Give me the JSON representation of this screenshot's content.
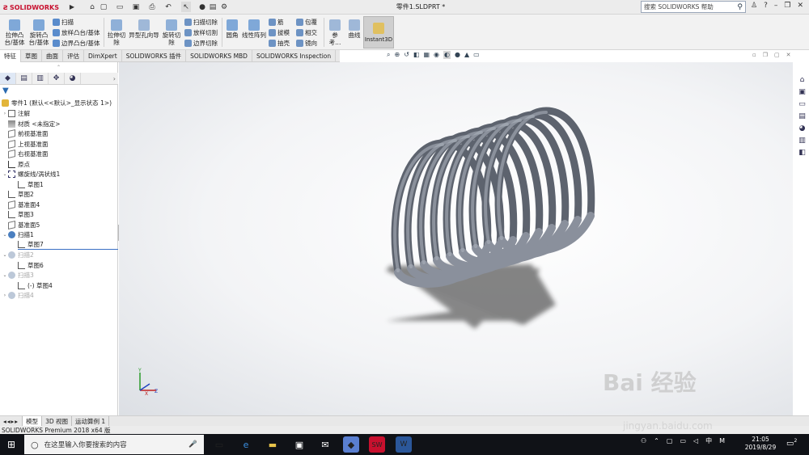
{
  "app": {
    "brand": "SOLIDWORKS",
    "document_title": "零件1.SLDPRT *"
  },
  "search": {
    "placeholder": "搜索 SOLIDWORKS 帮助"
  },
  "ribbon": {
    "extrude_boss": "拉伸凸\n台/基体",
    "revolve_boss": "旋转凸\n台/基体",
    "sweep": "扫描",
    "loft_boss": "放样凸台/基体",
    "boundary_boss": "边界凸台/基体",
    "extrude_cut": "拉伸切\n除",
    "hole_wizard": "异型孔向导",
    "revolve_cut": "旋转切\n除",
    "swept_cut": "扫描切除",
    "lofted_cut": "放样切割",
    "boundary_cut": "边界切除",
    "fillet": "圆角",
    "linear_pattern": "线性阵列",
    "rib": "筋",
    "draft": "拔模",
    "shell": "抽壳",
    "wrap": "包覆",
    "intersect": "相交",
    "mirror": "镜向",
    "reference": "参考...",
    "curves": "曲线",
    "instant3d": "Instant3D"
  },
  "command_tabs": [
    "特征",
    "草图",
    "曲面",
    "评估",
    "DimXpert",
    "SOLIDWORKS 插件",
    "SOLIDWORKS MBD",
    "SOLIDWORKS Inspection"
  ],
  "tree": {
    "root": "零件1 (默认<<默认>_显示状态 1>)",
    "items": [
      {
        "label": "注解"
      },
      {
        "label": "材质 <未指定>"
      },
      {
        "label": "前视基准面"
      },
      {
        "label": "上视基准面"
      },
      {
        "label": "右视基准面"
      },
      {
        "label": "原点"
      },
      {
        "label": "螺旋线/涡状线1"
      },
      {
        "label": "草图1"
      },
      {
        "label": "草图2"
      },
      {
        "label": "基准面4"
      },
      {
        "label": "草图3"
      },
      {
        "label": "基准面5"
      },
      {
        "label": "扫描1"
      },
      {
        "label": "草图7"
      },
      {
        "label": "扫描2"
      },
      {
        "label": "草图6"
      },
      {
        "label": "扫描3"
      },
      {
        "label": "(-) 草图4"
      },
      {
        "label": "扫描4"
      }
    ]
  },
  "bottom_tabs": [
    "模型",
    "3D 视图",
    "运动算例 1"
  ],
  "status": {
    "text": "SOLIDWORKS Premium 2018 x64 版"
  },
  "taskbar": {
    "search_placeholder": "在这里输入你要搜索的内容",
    "ime": "中",
    "ime2": "M",
    "time": "21:05",
    "date": "2019/8/29",
    "notif_count": "2"
  },
  "triad": {
    "x": "X",
    "y": "Y",
    "z": "Z"
  },
  "watermark": {
    "brand": "Bai 经验",
    "url": "jingyan.baidu.com"
  },
  "colors": {
    "spring": "#8a909c",
    "accent": "#c8102e"
  }
}
